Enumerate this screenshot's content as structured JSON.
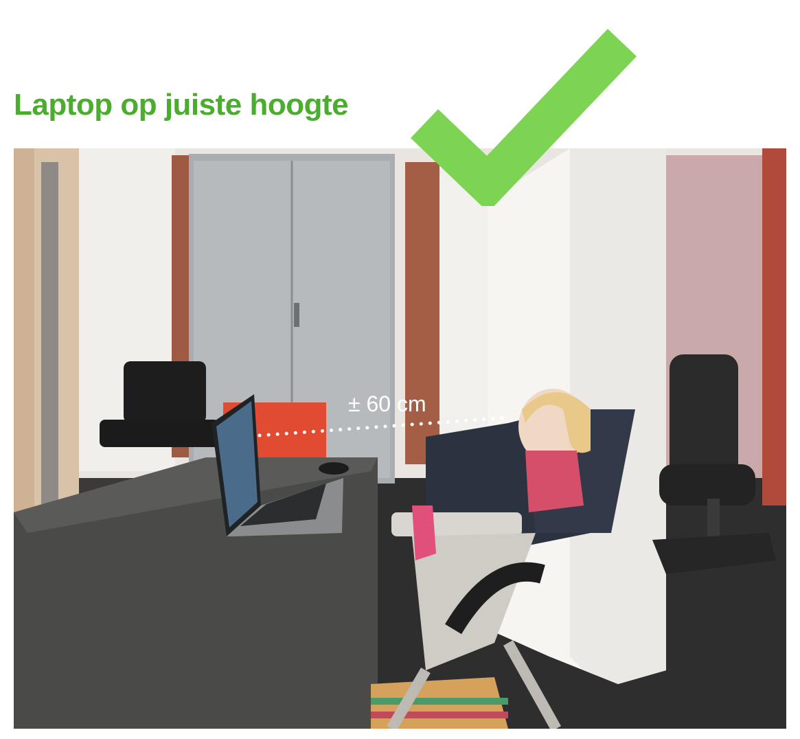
{
  "title": "Laptop op juiste hoogte",
  "measurement": {
    "label": "± 60 cm"
  },
  "icons": {
    "check": "checkmark-icon"
  },
  "colors": {
    "title_green": "#4aad2e",
    "check_green": "#7dd352",
    "label_white": "#ffffff"
  }
}
